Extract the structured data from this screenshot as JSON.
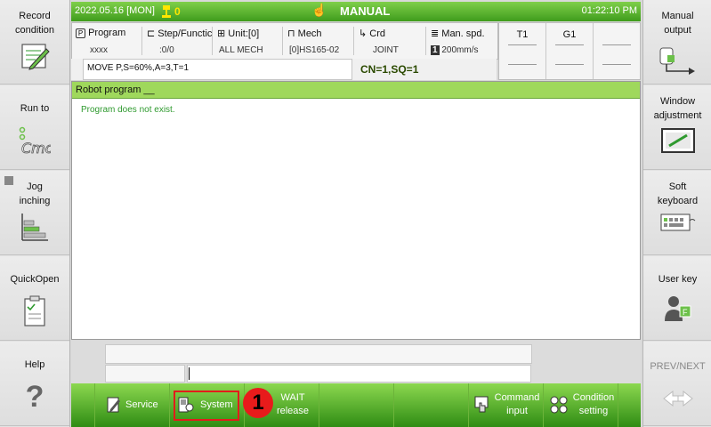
{
  "left_panel": [
    {
      "label_lines": [
        "Record",
        "condition"
      ],
      "icon": "pencil-icon"
    },
    {
      "label_lines": [
        "Run to"
      ],
      "icon": "cmd-icon"
    },
    {
      "label_lines": [
        "Jog",
        "inching"
      ],
      "icon": "stairs-icon"
    },
    {
      "label_lines": [
        "QuickOpen"
      ],
      "icon": "checklist-icon"
    },
    {
      "label_lines": [
        "Help"
      ],
      "icon": "question-icon"
    }
  ],
  "right_panel": [
    {
      "label_lines": [
        "Manual",
        "output"
      ],
      "icon": "output-icon"
    },
    {
      "label_lines": [
        "Window",
        "adjustment"
      ],
      "icon": "window-icon"
    },
    {
      "label_lines": [
        "Soft",
        "keyboard"
      ],
      "icon": "keyboard-icon"
    },
    {
      "label_lines": [
        "User key"
      ],
      "icon": "user-icon"
    },
    {
      "label_lines": [
        "PREV/NEXT"
      ],
      "icon": "arrows-icon",
      "disabled": true
    }
  ],
  "status": {
    "date": "2022.05.16 [MON]",
    "stack_count": "0",
    "mode": "MANUAL",
    "time": "01:22:10 PM"
  },
  "info": {
    "program": {
      "label": "Program",
      "value": "xxxx"
    },
    "step": {
      "label": "Step/Functic",
      "value": ":0/0"
    },
    "unit": {
      "label": "Unit:[0]",
      "value": "ALL MECH"
    },
    "mech": {
      "label": "Mech",
      "value": "[0]HS165-02"
    },
    "crd": {
      "label": "Crd",
      "value": "JOINT"
    },
    "speed": {
      "label": "Man. spd.",
      "value": "200mm/s",
      "level": "1"
    }
  },
  "tools": [
    {
      "label": "T1"
    },
    {
      "label": "G1"
    },
    {
      "label": ""
    }
  ],
  "command": {
    "text": "MOVE P,S=60%,A=3,T=1",
    "cn_sq": "CN=1,SQ=1"
  },
  "program_panel": {
    "header": "Robot program __",
    "message": "Program does not exist."
  },
  "function_keys": {
    "service": "Service",
    "system": "System",
    "wait_release": [
      "WAIT",
      "release"
    ],
    "command_input": [
      "Command",
      "input"
    ],
    "condition_setting": [
      "Condition",
      "setting"
    ]
  },
  "annotation_badge": "1",
  "colors": {
    "accent_green": "#3f9c1c",
    "highlight_red": "#e31b1b"
  }
}
